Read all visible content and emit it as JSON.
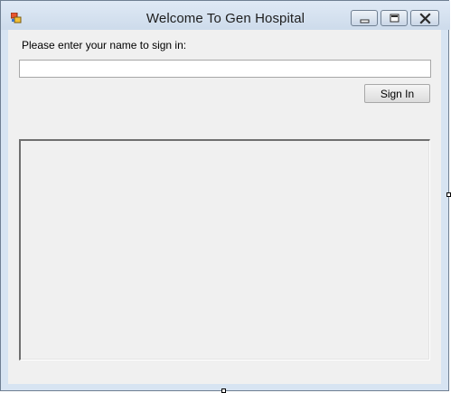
{
  "window": {
    "title": "Welcome To Gen Hospital",
    "icon": "app-form-icon",
    "caption_buttons": [
      "minimize-icon",
      "maximize-icon",
      "close-icon"
    ]
  },
  "form": {
    "prompt_label": "Please enter your name to sign in:",
    "name_input_value": "",
    "sign_in_label": "Sign In"
  },
  "output_panel": {
    "content": ""
  },
  "colors": {
    "titlebar": "#d7e4f2",
    "client_background": "#f0f0f0",
    "border": "#6f7f92"
  }
}
